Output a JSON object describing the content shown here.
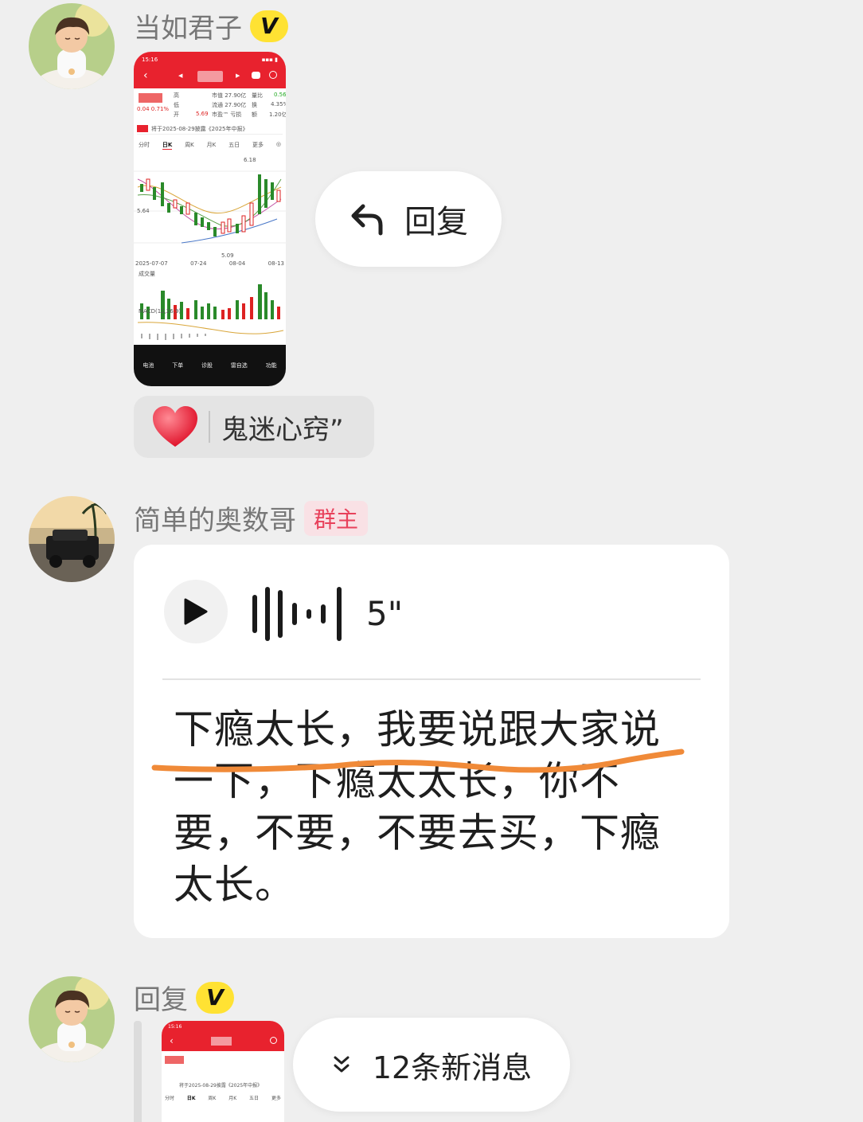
{
  "messages": [
    {
      "sender": "当如君子",
      "badge": "V",
      "image": {
        "status_time": "15:16",
        "tabs": [
          "分时",
          "日K",
          "周K",
          "月K",
          "五日",
          "更多"
        ],
        "notice": "将于2025-08-29披露《2025年中报》",
        "stats": {
          "price_change": "0.04  0.71%",
          "high": "高",
          "low": "低",
          "open": "开",
          "market_cap": "市值 27.90亿",
          "float_cap": "流通 27.90亿",
          "pe": "市盈™ 亏损",
          "vol_ratio_label": "量比",
          "vol_ratio": "0.56",
          "turnover_label": "换",
          "turnover": "4.35%",
          "amount_label": "额",
          "amount": "1.20亿",
          "open_value": "5.69"
        },
        "price_axis": [
          "6.18",
          "5.64",
          "5.09"
        ],
        "date_axis": [
          "2025-07-07",
          "07-24",
          "08-04",
          "08-13"
        ],
        "volume_label": "成交量",
        "macd_label": "MACD(12,26,9)",
        "bottom_nav": [
          "电池",
          "下单",
          "诊股",
          "雷自选",
          "功能"
        ]
      }
    },
    {
      "sender": "简单的奥数哥",
      "badge": "群主",
      "voice": {
        "duration": "5\"",
        "transcript": "下瘾太长，我要说跟大家说一下，下瘾太太长，你不要，不要，不要去买，下瘾太长。"
      }
    },
    {
      "sender": "回复",
      "badge": "V",
      "image": {
        "status_time": "15:16",
        "tabs": [
          "分时",
          "日K",
          "周K",
          "月K",
          "五日",
          "更多"
        ],
        "notice": "将于2025-08-29披露《2025年中报》"
      }
    }
  ],
  "reply_popup": {
    "icon": "reply-arrow-icon",
    "label": "回复"
  },
  "reaction": {
    "icon": "heart-icon",
    "names": "鬼迷心窍”"
  },
  "new_messages": {
    "icon": "double-chevron-down-icon",
    "label": "12条新消息"
  },
  "colors": {
    "accent_red": "#e8222e",
    "badge_yellow": "#ffe233",
    "owner_pink": "#e8415b",
    "underline_orange": "#f08a38"
  }
}
